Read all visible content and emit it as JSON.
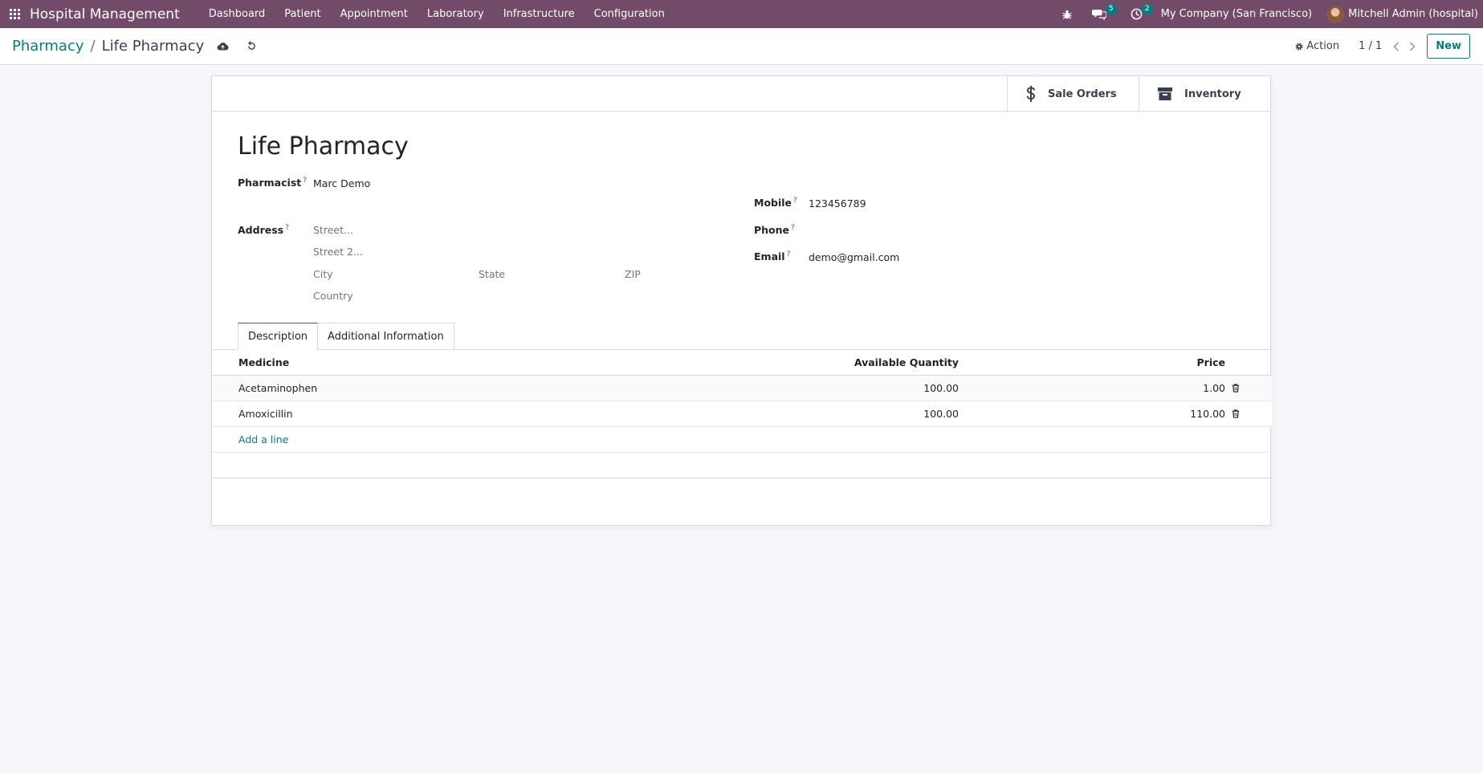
{
  "navbar": {
    "brand": "Hospital Management",
    "menu": [
      "Dashboard",
      "Patient",
      "Appointment",
      "Laboratory",
      "Infrastructure",
      "Configuration"
    ],
    "messages_count": "5",
    "activities_count": "2",
    "company": "My Company (San Francisco)",
    "user": "Mitchell Admin (hospital)"
  },
  "breadcrumb": {
    "parent": "Pharmacy",
    "separator": "/",
    "current": "Life Pharmacy"
  },
  "control": {
    "action_label": "Action",
    "pager": "1 / 1",
    "new_label": "New"
  },
  "smart_buttons": {
    "sale_orders": "Sale Orders",
    "inventory": "Inventory"
  },
  "form": {
    "title": "Life Pharmacy",
    "pharmacist_label": "Pharmacist",
    "pharmacist_value": "Marc Demo",
    "address_label": "Address",
    "street_placeholder": "Street...",
    "street2_placeholder": "Street 2...",
    "city_placeholder": "City",
    "state_placeholder": "State",
    "zip_placeholder": "ZIP",
    "country_placeholder": "Country",
    "mobile_label": "Mobile",
    "mobile_value": "123456789",
    "phone_label": "Phone",
    "phone_value": "",
    "email_label": "Email",
    "email_value": "demo@gmail.com",
    "help_mark": "?"
  },
  "tabs": [
    "Description",
    "Additional Information"
  ],
  "table": {
    "headers": {
      "medicine": "Medicine",
      "quantity": "Available Quantity",
      "price": "Price"
    },
    "rows": [
      {
        "medicine": "Acetaminophen",
        "quantity": "100.00",
        "price": "1.00"
      },
      {
        "medicine": "Amoxicillin",
        "quantity": "100.00",
        "price": "110.00"
      }
    ],
    "add_line": "Add a line"
  },
  "colors": {
    "navbar": "#714b67",
    "accent": "#017e84"
  }
}
